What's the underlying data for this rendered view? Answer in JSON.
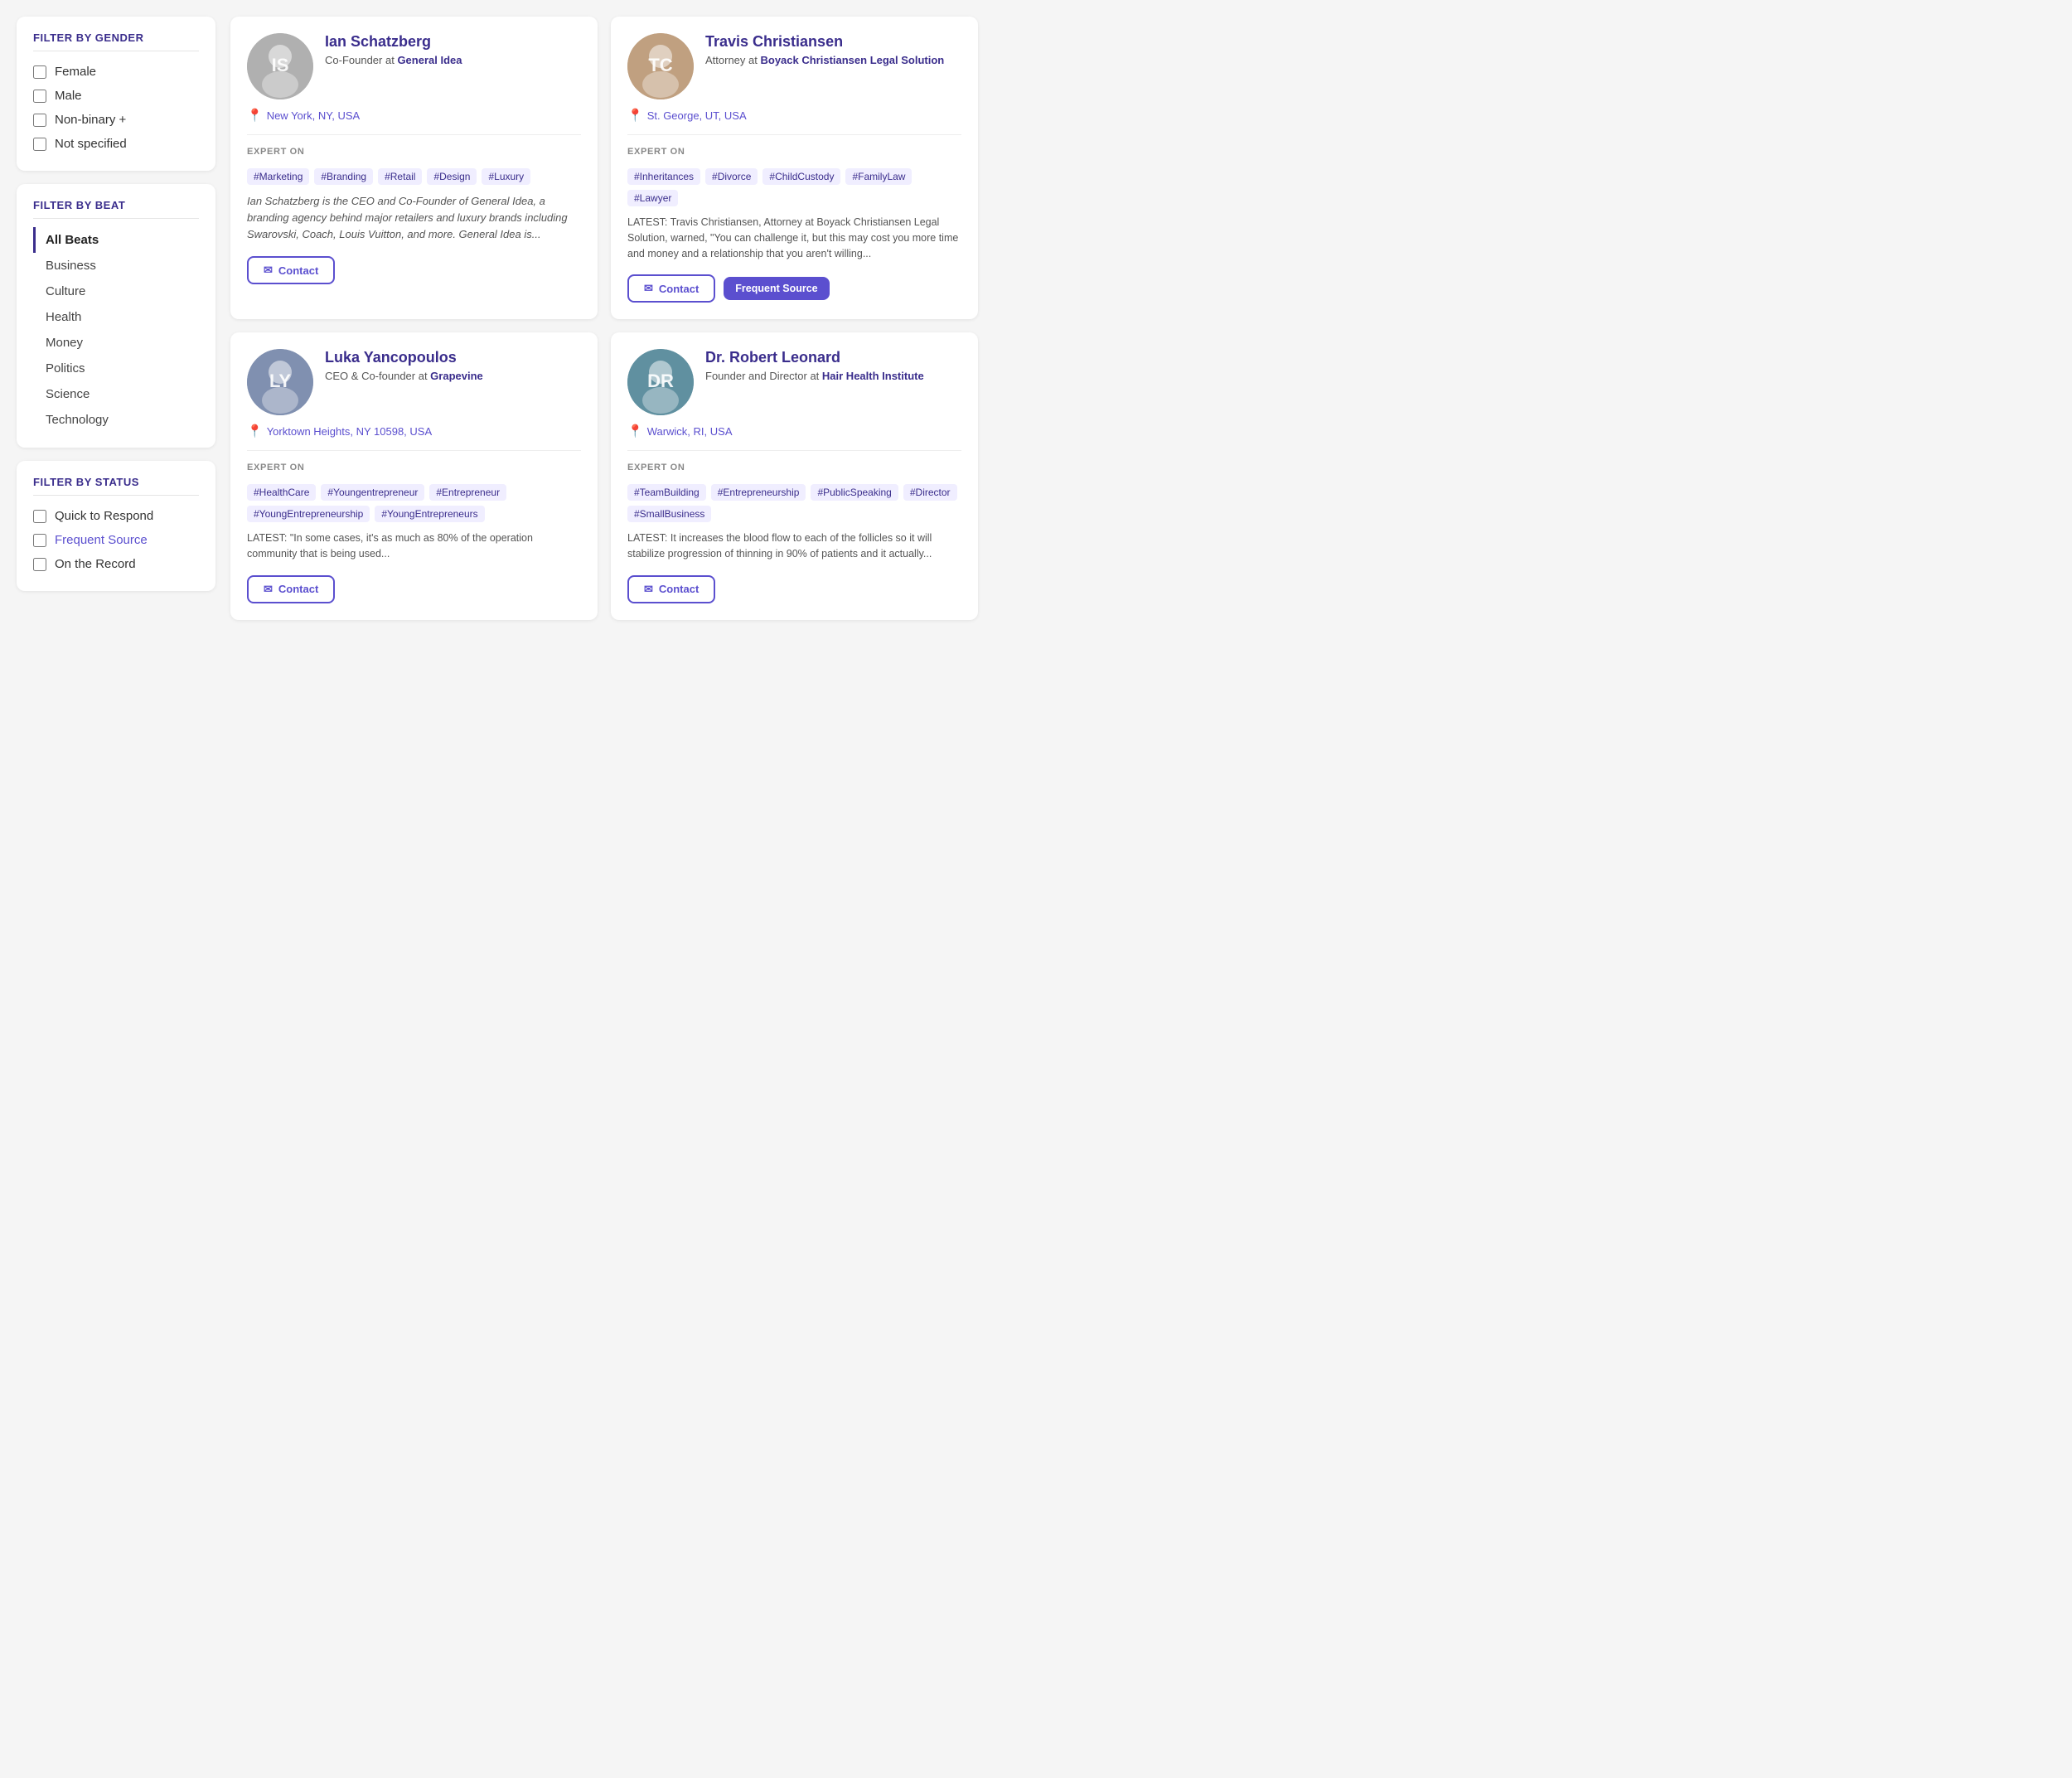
{
  "sidebar": {
    "filter_gender": {
      "title": "FILTER BY GENDER",
      "options": [
        {
          "label": "Female",
          "checked": false
        },
        {
          "label": "Male",
          "checked": false
        },
        {
          "label": "Non-binary +",
          "checked": false
        },
        {
          "label": "Not specified",
          "checked": false
        }
      ]
    },
    "filter_beat": {
      "title": "FILTER BY BEAT",
      "items": [
        {
          "label": "All Beats",
          "active": true
        },
        {
          "label": "Business",
          "active": false
        },
        {
          "label": "Culture",
          "active": false
        },
        {
          "label": "Health",
          "active": false
        },
        {
          "label": "Money",
          "active": false
        },
        {
          "label": "Politics",
          "active": false
        },
        {
          "label": "Science",
          "active": false
        },
        {
          "label": "Technology",
          "active": false
        }
      ]
    },
    "filter_status": {
      "title": "FILTER BY STATUS",
      "options": [
        {
          "label": "Quick to Respond",
          "checked": false
        },
        {
          "label": "Frequent Source",
          "checked": false
        },
        {
          "label": "On the Record",
          "checked": false
        }
      ]
    }
  },
  "experts": [
    {
      "id": "ian-schatzberg",
      "name": "Ian Schatzberg",
      "role": "Co-Founder at",
      "company": "General Idea",
      "location": "New York, NY, USA",
      "expert_on_label": "EXPERT ON",
      "tags": [
        "#Marketing",
        "#Branding",
        "#Retail",
        "#Design",
        "#Luxury"
      ],
      "bio": "Ian Schatzberg is the CEO and Co-Founder of General Idea, a branding agency behind major retailers and luxury brands including Swarovski, Coach, Louis Vuitton, and more. General Idea is...",
      "latest": null,
      "contact_label": "Contact",
      "frequent_source": false
    },
    {
      "id": "travis-christiansen",
      "name": "Travis Christiansen",
      "role": "Attorney at",
      "company": "Boyack Christiansen Legal Solution",
      "location": "St. George, UT, USA",
      "expert_on_label": "EXPERT ON",
      "tags": [
        "#Inheritances",
        "#Divorce",
        "#ChildCustody",
        "#FamilyLaw",
        "#Lawyer"
      ],
      "bio": null,
      "latest": "LATEST: Travis Christiansen, Attorney at Boyack Christiansen Legal Solution, warned, \"You can challenge it, but this may cost you more time and money and a relationship that you aren't willing...",
      "contact_label": "Contact",
      "frequent_source": true,
      "frequent_source_label": "Frequent Source"
    },
    {
      "id": "luka-yancopoulos",
      "name": "Luka Yancopoulos",
      "role": "CEO & Co-founder at",
      "company": "Grapevine",
      "location": "Yorktown Heights, NY 10598, USA",
      "expert_on_label": "EXPERT ON",
      "tags": [
        "#HealthCare",
        "#Youngentrepreneur",
        "#Entrepreneur",
        "#YoungEntrepreneurship",
        "#YoungEntrepreneurs"
      ],
      "bio": null,
      "latest": "LATEST: \"In some cases, it's as much as 80% of the operation community that is being used...",
      "contact_label": "Contact",
      "frequent_source": false
    },
    {
      "id": "dr-robert-leonard",
      "name": "Dr. Robert Leonard",
      "role": "Founder and Director at",
      "company": "Hair Health Institute",
      "location": "Warwick, RI, USA",
      "expert_on_label": "EXPERT ON",
      "tags": [
        "#TeamBuilding",
        "#Entrepreneurship",
        "#PublicSpeaking",
        "#Director",
        "#SmallBusiness"
      ],
      "bio": null,
      "latest": "LATEST: It increases the blood flow to each of the follicles so it will stabilize progression of thinning in 90% of patients and it actually...",
      "contact_label": "Contact",
      "frequent_source": false
    }
  ]
}
